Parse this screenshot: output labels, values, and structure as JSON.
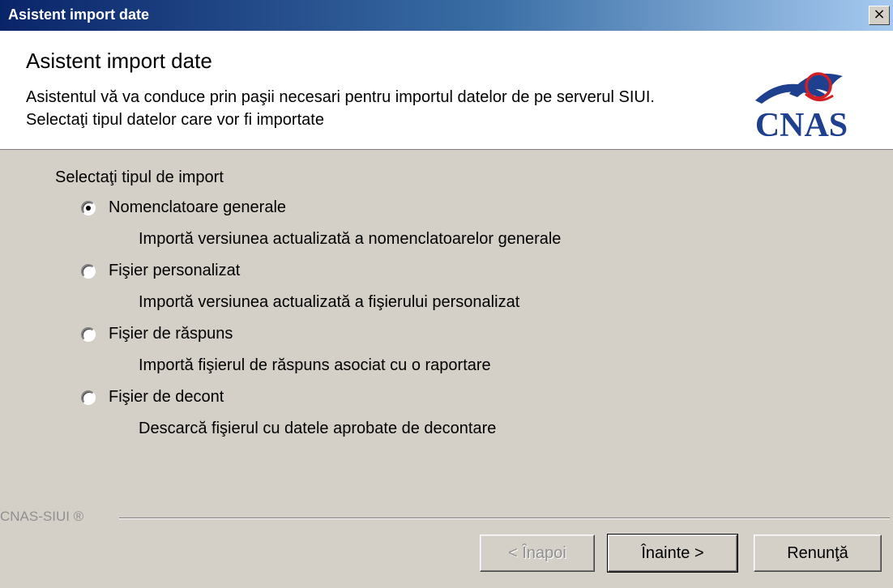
{
  "window": {
    "title": "Asistent import date",
    "close_label": "×"
  },
  "header": {
    "title": "Asistent import date",
    "description": "Asistentul vă va conduce prin paşii necesari pentru importul datelor de pe serverul SIUI. Selectaţi tipul datelor care vor fi importate",
    "logo_text": "CNAS"
  },
  "import_section": {
    "label": "Selectaţi tipul de import",
    "options": [
      {
        "label": "Nomenclatoare generale",
        "description": "Importă versiunea actualizată a nomenclatoarelor generale",
        "selected": true
      },
      {
        "label": "Fişier personalizat",
        "description": "Importă versiunea actualizată a fişierului personalizat",
        "selected": false
      },
      {
        "label": "Fişier de răspuns",
        "description": "Importă fişierul de răspuns asociat cu o raportare",
        "selected": false
      },
      {
        "label": "Fişier de decont",
        "description": "Descarcă fişierul cu datele aprobate de decontare",
        "selected": false
      }
    ]
  },
  "footer": {
    "brand": "CNAS-SIUI ®",
    "back_label": "< Înapoi",
    "next_label": "Înainte >",
    "cancel_label": "Renunţă"
  },
  "colors": {
    "title_bar": "#0a246a",
    "dialog_background": "#d4d0c8",
    "logo_blue": "#1f3f8f",
    "logo_red": "#d21f26"
  }
}
